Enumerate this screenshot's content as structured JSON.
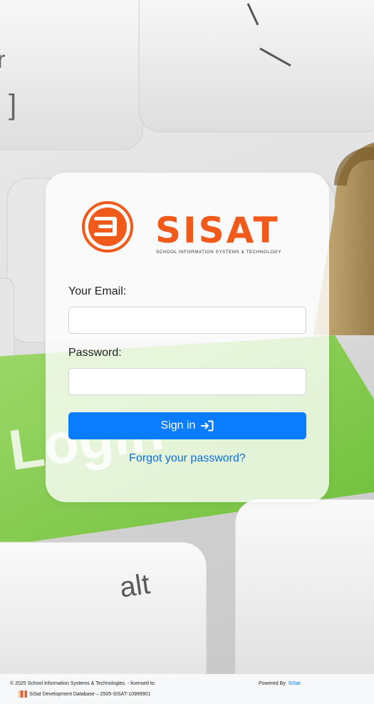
{
  "brand": {
    "name": "SISAT",
    "tagline": "SCHOOL INFORMATION SYSTEMS & TECHNOLOGY",
    "primary_color": "#f05a1a"
  },
  "background": {
    "key_text_alt": "alt",
    "key_text_login": "Login"
  },
  "form": {
    "email_label": "Your Email:",
    "email_value": "",
    "password_label": "Password:",
    "password_value": "",
    "signin_label": "Sign in",
    "signin_icon": "sign-in-arrow-icon",
    "forgot_label": "Forgot your password?",
    "accent_color": "#0a7cff"
  },
  "footer": {
    "copyright": "© 2025 School Information Systems & Technologies. - licensed to:",
    "powered_by_label": "Powered By:",
    "powered_by_link": "SiSat",
    "license_text": "SiSat Development Database – 2505-SISAT-10999901"
  }
}
